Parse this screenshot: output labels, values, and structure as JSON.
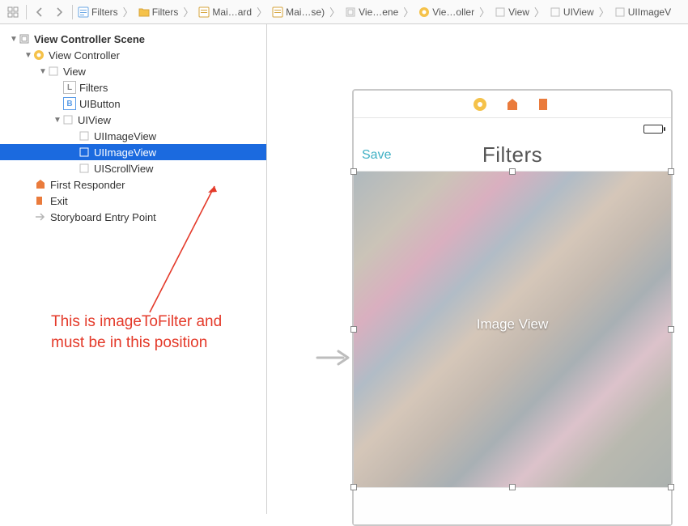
{
  "breadcrumbs": [
    {
      "label": "Filters",
      "icon": "swift"
    },
    {
      "label": "Filters",
      "icon": "folder"
    },
    {
      "label": "Mai…ard",
      "icon": "storyboard"
    },
    {
      "label": "Mai…se)",
      "icon": "storyboard"
    },
    {
      "label": "Vie…ene",
      "icon": "scene"
    },
    {
      "label": "Vie…oller",
      "icon": "vc"
    },
    {
      "label": "View",
      "icon": "view"
    },
    {
      "label": "UIView",
      "icon": "view"
    },
    {
      "label": "UIImageV",
      "icon": "view"
    }
  ],
  "outline": {
    "scene": "View Controller Scene",
    "vc": "View Controller",
    "view": "View",
    "filters": "Filters",
    "uibutton": "UIButton",
    "uiview": "UIView",
    "img1": "UIImageView",
    "img2": "UIImageView",
    "scroll": "UIScrollView",
    "first_responder": "First Responder",
    "exit": "Exit",
    "entry": "Storyboard Entry Point"
  },
  "device": {
    "save": "Save",
    "title": "Filters",
    "image_label": "Image View"
  },
  "annotation": {
    "line1": "This is imageToFilter and",
    "line2": "must be in this position"
  }
}
